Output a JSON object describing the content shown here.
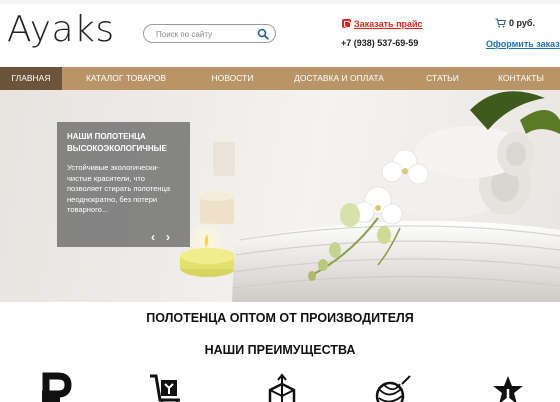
{
  "header": {
    "logo": "Ayaks",
    "search_placeholder": "Поиск по сайту",
    "price_link": "Заказать прайс",
    "phone": "+7 (938) 537-69-59",
    "cart_total": "0 руб.",
    "checkout_link": "Оформить заказ"
  },
  "nav": {
    "items": [
      {
        "label": "ГЛАВНАЯ",
        "active": true
      },
      {
        "label": "КАТАЛОГ ТОВАРОВ"
      },
      {
        "label": "НОВОСТИ"
      },
      {
        "label": "ДОСТАВКА И ОПЛАТА"
      },
      {
        "label": "СТАТЬИ"
      },
      {
        "label": "КОНТАКТЫ"
      }
    ]
  },
  "hero": {
    "slide_title": "НАШИ ПОЛОТЕНЦА ВЫСОКОЭКОЛОГИЧНЫЕ",
    "slide_text": "Устойчивые экологически-чистые красители, что позволяет стирать полотенца неоднократно, без потери товарного...",
    "prev_arrow": "‹",
    "next_arrow": "›"
  },
  "main": {
    "title": "ПОЛОТЕНЦА ОПТОМ ОТ ПРОИЗВОДИТЕЛЯ",
    "advantages_title": "НАШИ ПРЕИМУЩЕСТВА",
    "advantage_icons": [
      "ruble-icon",
      "delivery-cart-icon",
      "box-icon",
      "yarn-icon",
      "star-icon"
    ]
  },
  "colors": {
    "nav_bg": "#b89467",
    "nav_active": "#6b5439",
    "accent_red": "#e2231a",
    "link_blue": "#1e6fb8"
  }
}
